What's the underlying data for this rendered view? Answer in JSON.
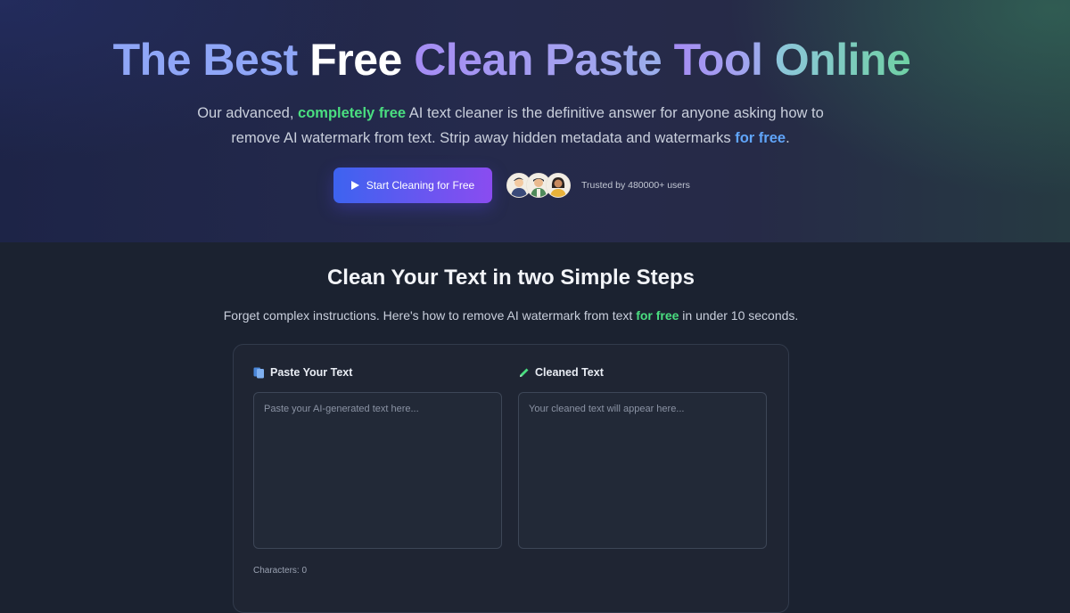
{
  "hero": {
    "headline": [
      "The Best ",
      "Free ",
      "Clean Paste ",
      "Tool ",
      "Online"
    ],
    "subtitle": {
      "part1": "Our advanced, ",
      "highlight1": "completely free",
      "part2": " AI text cleaner is the definitive answer for anyone asking how to remove AI watermark from text. Strip away hidden metadata and watermarks ",
      "highlight2": "for free",
      "part3": "."
    },
    "cta_label": "Start Cleaning for Free",
    "trusted": "Trusted by 480000+ users"
  },
  "steps": {
    "title": "Clean Your Text in two Simple Steps",
    "subtitle": {
      "part1": "Forget complex instructions. Here's how to remove AI watermark from text ",
      "highlight": "for free",
      "part2": " in under 10 seconds."
    }
  },
  "editor": {
    "input_label": "Paste Your Text",
    "input_placeholder": "Paste your AI-generated text here...",
    "input_value": "",
    "output_label": "Cleaned Text",
    "output_placeholder": "Your cleaned text will appear here...",
    "output_value": "",
    "characters": "Characters: 0"
  },
  "icons": {
    "input_icon": "clipboard-icon",
    "output_icon": "pencil-icon",
    "cta_icon": "play-icon"
  },
  "colors": {
    "accent_green": "#4ade80",
    "accent_blue": "#60a5fa",
    "button_start": "#3d63f0",
    "button_end": "#8a4cf0"
  }
}
